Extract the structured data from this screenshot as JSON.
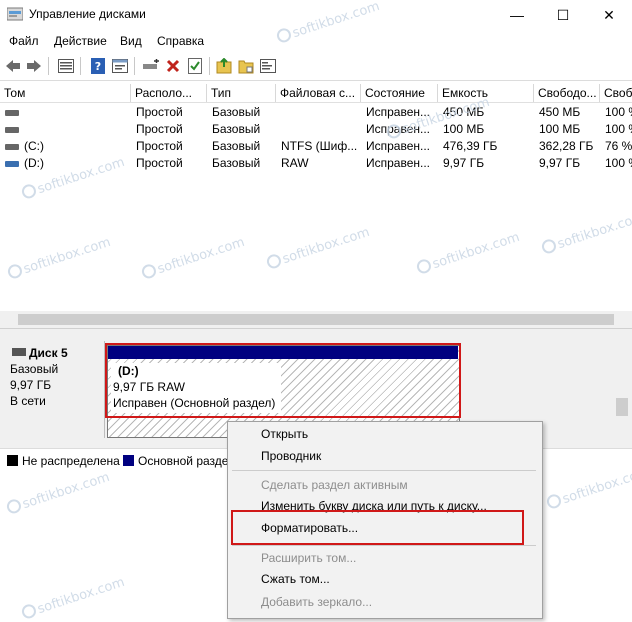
{
  "window": {
    "title": "Управление дисками",
    "min_glyph": "—",
    "max_glyph": "☐",
    "close_glyph": "✕"
  },
  "menu": [
    "Файл",
    "Действие",
    "Вид",
    "Справка"
  ],
  "toolbar_icons": [
    "back-arrow-icon",
    "forward-arrow-icon",
    "list-view-icon",
    "help-icon",
    "properties-icon",
    "connect-disk-icon",
    "delete-icon",
    "check-icon",
    "open-folder-icon",
    "folder-icon",
    "settings-icon"
  ],
  "volume_table": {
    "columns": [
      "Том",
      "Располо...",
      "Тип",
      "Файловая с...",
      "Состояние",
      "Емкость",
      "Свободо...",
      "Своб"
    ],
    "rows": [
      {
        "name": "",
        "layout": "Простой",
        "type": "Базовый",
        "fs": "",
        "status": "Исправен...",
        "capacity": "450 МБ",
        "free": "450 МБ",
        "pct": "100 %"
      },
      {
        "name": "",
        "layout": "Простой",
        "type": "Базовый",
        "fs": "",
        "status": "Исправен...",
        "capacity": "100 МБ",
        "free": "100 МБ",
        "pct": "100 %"
      },
      {
        "name": "(C:)",
        "layout": "Простой",
        "type": "Базовый",
        "fs": "NTFS (Шиф...",
        "status": "Исправен...",
        "capacity": "476,39 ГБ",
        "free": "362,28 ГБ",
        "pct": "76 %"
      },
      {
        "name": "(D:)",
        "layout": "Простой",
        "type": "Базовый",
        "fs": "RAW",
        "status": "Исправен...",
        "capacity": "9,97 ГБ",
        "free": "9,97 ГБ",
        "pct": "100 %"
      }
    ]
  },
  "disk": {
    "name": "Диск 5",
    "kind": "Базовый",
    "size": "9,97 ГБ",
    "state": "В сети",
    "partition": {
      "label": "(D:)",
      "size_fs": "9,97 ГБ RAW",
      "status": "Исправен (Основной раздел)"
    }
  },
  "legend": [
    {
      "label": "Не распределена",
      "color": "#000000"
    },
    {
      "label": "Основной разде",
      "color": "#000080"
    }
  ],
  "context_menu": {
    "items": [
      {
        "label": "Открыть",
        "enabled": true
      },
      {
        "label": "Проводник",
        "enabled": true
      },
      {
        "label": "Сделать раздел активным",
        "enabled": false
      },
      {
        "label": "Изменить букву диска или путь к диску...",
        "enabled": true
      },
      {
        "label": "Форматировать...",
        "enabled": true
      },
      {
        "label": "Расширить том...",
        "enabled": false
      },
      {
        "label": "Сжать том...",
        "enabled": true
      },
      {
        "label": "Добавить зеркало...",
        "enabled": false
      }
    ]
  },
  "watermark": "softikbox.com",
  "colors": {
    "primary_partition": "#000080",
    "highlight_red": "#d01818",
    "unallocated": "#000000"
  }
}
